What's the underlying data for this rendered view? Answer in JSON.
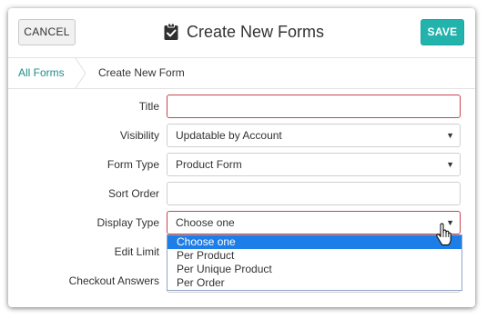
{
  "header": {
    "cancel_label": "CANCEL",
    "title": "Create New Forms",
    "title_icon": "clipboard-check-icon",
    "save_label": "SAVE",
    "save_color": "#21b3ac"
  },
  "breadcrumb": {
    "items": [
      "All Forms",
      "Create New Form"
    ]
  },
  "form": {
    "title": {
      "label": "Title",
      "value": ""
    },
    "visibility": {
      "label": "Visibility",
      "value": "Updatable by Account"
    },
    "form_type": {
      "label": "Form Type",
      "value": "Product Form"
    },
    "sort_order": {
      "label": "Sort Order",
      "value": ""
    },
    "display_type": {
      "label": "Display Type",
      "value": "Choose one"
    },
    "edit_limit": {
      "label": "Edit Limit"
    },
    "checkout_answers": {
      "label": "Checkout Answers"
    }
  },
  "dropdown": {
    "options": [
      "Choose one",
      "Per Product",
      "Per Unique Product",
      "Per Order"
    ],
    "selected_index": 0,
    "highlight_color": "#1e7ee8"
  }
}
